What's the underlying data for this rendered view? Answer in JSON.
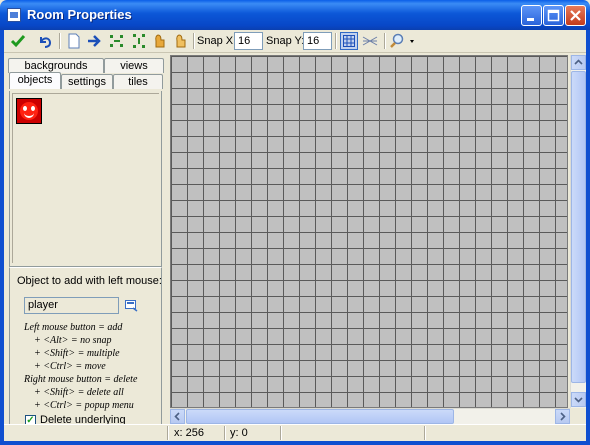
{
  "window": {
    "title": "Room Properties",
    "minimize_icon": "minimize-icon",
    "maximize_icon": "maximize-icon",
    "close_icon": "close-icon"
  },
  "toolbar": {
    "icons": [
      "ok-check-icon",
      "undo-icon",
      "clear-room-icon",
      "shift-icon",
      "sort-x-icon",
      "sort-y-icon",
      "lock-icon",
      "unlock-icon",
      "grid-toggle-icon",
      "isometric-icon",
      "zoom-icon"
    ],
    "snap_x_label": "Snap X:",
    "snap_x_value": "16",
    "snap_y_label": "Snap Y:",
    "snap_y_value": "16"
  },
  "tabs": {
    "row1": [
      "backgrounds",
      "views"
    ],
    "row2": [
      "objects",
      "settings",
      "tiles"
    ],
    "active": "objects"
  },
  "objects_panel": {
    "selected_sprite_icon": "red-smiley-sprite",
    "object_label": "Object to add with left mouse:",
    "object_value": "player"
  },
  "help_lines": [
    "Left mouse button = add",
    "+ <Alt> = no snap",
    "+ <Shift> = multiple",
    "+ <Ctrl> = move",
    "Right mouse button = delete",
    "+ <Shift> = delete all",
    "+ <Ctrl> = popup menu"
  ],
  "delete_underlying": {
    "label": "Delete underlying",
    "checked": true
  },
  "status": {
    "x": "x: 256",
    "y": "y: 0"
  },
  "colors": {
    "room_bg": "#c0c0c0",
    "grid_line": "#5a5a5a",
    "titlebar": "#0c57d8"
  }
}
